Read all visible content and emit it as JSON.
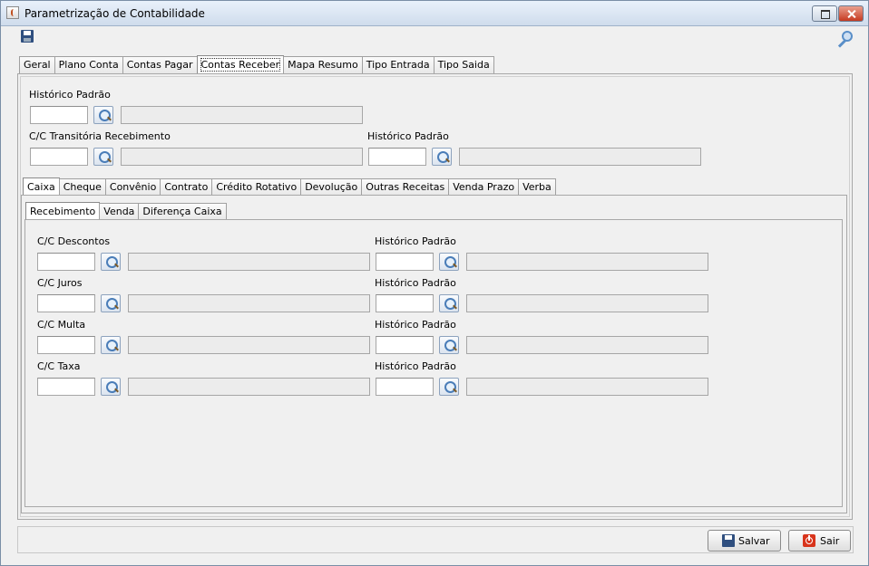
{
  "window": {
    "title": "Parametrização de Contabilidade"
  },
  "main_tabs": [
    {
      "label": "Geral",
      "active": false
    },
    {
      "label": "Plano Conta",
      "active": false
    },
    {
      "label": "Contas Pagar",
      "active": false
    },
    {
      "label": "Contas Receber",
      "active": true
    },
    {
      "label": "Mapa Resumo",
      "active": false
    },
    {
      "label": "Tipo Entrada",
      "active": false
    },
    {
      "label": "Tipo Saida",
      "active": false
    }
  ],
  "contas_receber": {
    "historico_padrao_label": "Histórico Padrão",
    "cc_transitoria_label": "C/C Transitória Recebimento",
    "cc_transitoria_hist_label": "Histórico Padrão",
    "codigo_value": "",
    "descricao_value": ""
  },
  "sub_tabs": [
    {
      "label": "Caixa",
      "active": true
    },
    {
      "label": "Cheque",
      "active": false
    },
    {
      "label": "Convênio",
      "active": false
    },
    {
      "label": "Contrato",
      "active": false
    },
    {
      "label": "Crédito Rotativo",
      "active": false
    },
    {
      "label": "Devolução",
      "active": false
    },
    {
      "label": "Outras Receitas",
      "active": false
    },
    {
      "label": "Venda Prazo",
      "active": false
    },
    {
      "label": "Verba",
      "active": false
    }
  ],
  "caixa_tabs": [
    {
      "label": "Recebimento",
      "active": true
    },
    {
      "label": "Venda",
      "active": false
    },
    {
      "label": "Diferença Caixa",
      "active": false
    }
  ],
  "recebimento": {
    "rows": [
      {
        "conta_label": "C/C Descontos",
        "hist_label": "Histórico Padrão"
      },
      {
        "conta_label": "C/C Juros",
        "hist_label": "Histórico Padrão"
      },
      {
        "conta_label": "C/C Multa",
        "hist_label": "Histórico Padrão"
      },
      {
        "conta_label": "C/C Taxa",
        "hist_label": "Histórico Padrão"
      }
    ]
  },
  "buttons": {
    "salvar": "Salvar",
    "sair": "Sair"
  },
  "icons": {
    "toolbar_save": "save-icon",
    "toolbar_key": "key-icon",
    "lookup": "search-icon",
    "salvar": "save-icon",
    "sair": "power-icon"
  }
}
